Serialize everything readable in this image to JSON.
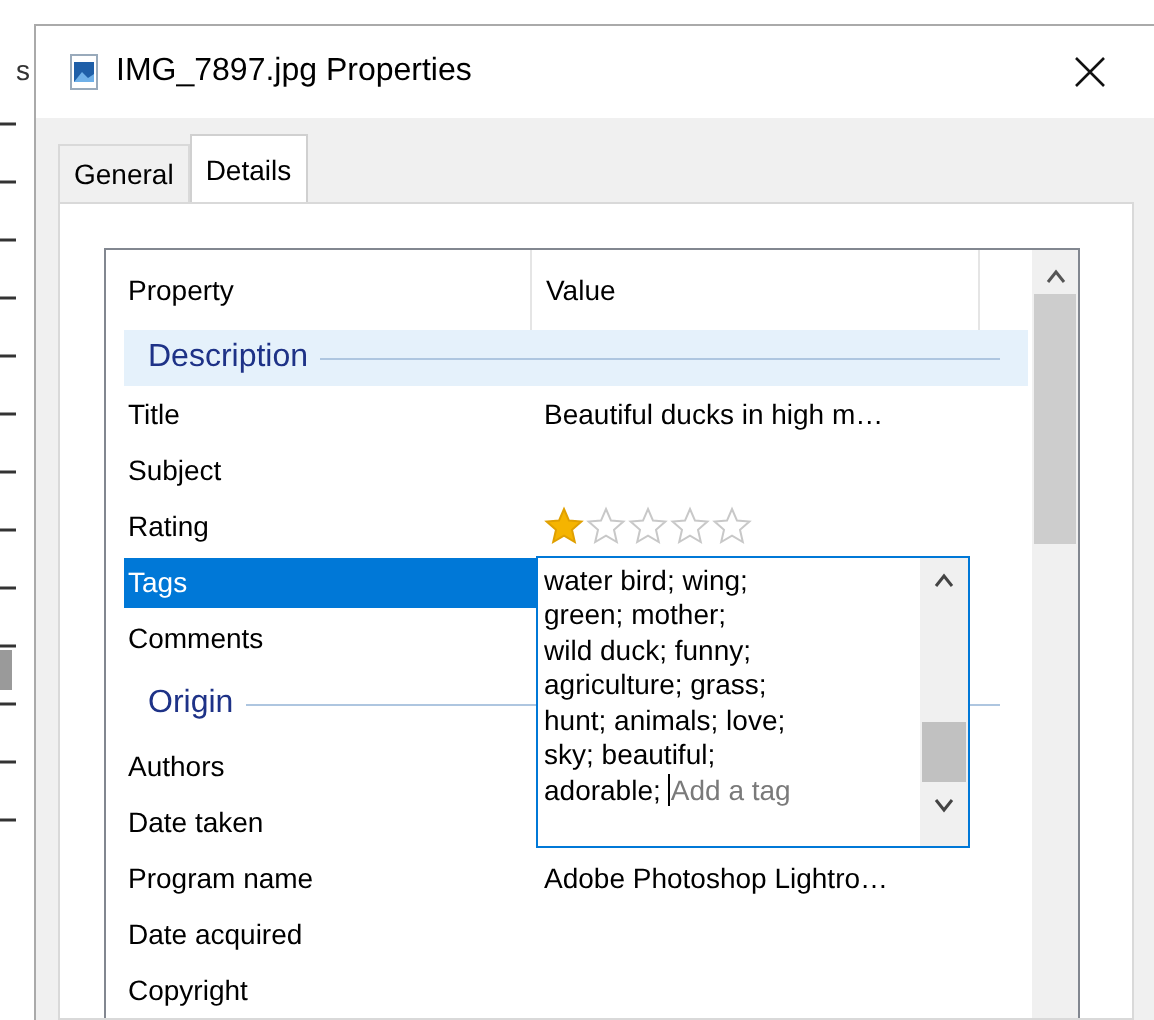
{
  "background_window": {
    "text": "s"
  },
  "window": {
    "title": "IMG_7897.jpg Properties"
  },
  "tabs": [
    {
      "label": "General",
      "selected": false
    },
    {
      "label": "Details",
      "selected": true
    }
  ],
  "list": {
    "columns": [
      "Property",
      "Value"
    ],
    "rows": [
      {
        "kind": "group",
        "label": "Description",
        "highlighted": true
      },
      {
        "kind": "property",
        "name": "Title",
        "value": "Beautiful ducks in high m…",
        "selected": false
      },
      {
        "kind": "property",
        "name": "Subject",
        "selected": false
      },
      {
        "kind": "rating",
        "name": "Rating",
        "stars": 1,
        "selected": false
      },
      {
        "kind": "tags",
        "name": "Tags",
        "selected": true,
        "editor": {
          "lines": [
            "water bird; wing;",
            "green; mother;",
            "wild duck; funny;",
            "agriculture; grass;",
            "hunt; animals; love;",
            "sky; beautiful;",
            "adorable;"
          ],
          "placeholder": "Add a tag"
        }
      },
      {
        "kind": "property",
        "name": "Comments",
        "selected": false
      },
      {
        "kind": "group",
        "label": "Origin",
        "highlighted": false
      },
      {
        "kind": "property",
        "name": "Authors",
        "selected": false
      },
      {
        "kind": "property",
        "name": "Date taken",
        "selected": false
      },
      {
        "kind": "property",
        "name": "Program name",
        "value": "Adobe Photoshop Lightro…",
        "selected": false
      },
      {
        "kind": "property",
        "name": "Date acquired",
        "selected": false
      },
      {
        "kind": "property",
        "name": "Copyright",
        "selected": false
      }
    ]
  }
}
